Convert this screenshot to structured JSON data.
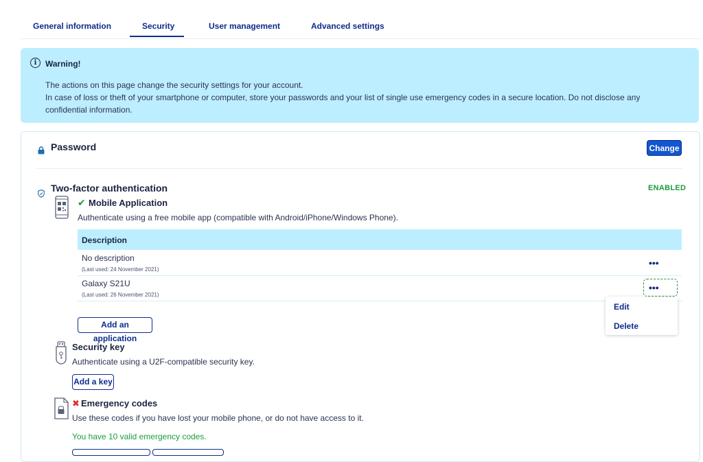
{
  "tabs": [
    {
      "label": "General information"
    },
    {
      "label": "Security"
    },
    {
      "label": "User management"
    },
    {
      "label": "Advanced settings"
    }
  ],
  "active_tab": "Security",
  "warning": {
    "title": "Warning!",
    "line1": "The actions on this page change the security settings for your account.",
    "line2": "In case of loss or theft of your smartphone or computer, store your passwords and your list of single use emergency codes in a secure location. Do not disclose any confidential information."
  },
  "password": {
    "title": "Password",
    "change_label": "Change"
  },
  "two_factor": {
    "title": "Two-factor authentication",
    "status": "ENABLED",
    "mobile": {
      "title": "Mobile Application",
      "description": "Authenticate using a free mobile app (compatible with Android/iPhone/Windows Phone).",
      "table_header": "Description",
      "rows": [
        {
          "name": "No description",
          "last_used": "(Last used: 24 November 2021)"
        },
        {
          "name": "Galaxy S21U",
          "last_used": "(Last used: 26 November 2021)"
        }
      ],
      "actions_label": "•••",
      "menu": {
        "edit": "Edit",
        "delete": "Delete"
      },
      "add_label": "Add an application"
    },
    "security_key": {
      "title": "Security key",
      "description": "Authenticate using a U2F-compatible security key.",
      "add_label": "Add a key"
    },
    "emergency": {
      "title": "Emergency codes",
      "description": "Use these codes if you have lost your mobile phone, or do not have access to it.",
      "valid_text": "You have 10 valid emergency codes."
    }
  },
  "colors": {
    "primary": "#0d2c8c",
    "button_fill": "#1256d0",
    "info_bg": "#bdeeff",
    "success": "#1a9c3d",
    "error": "#e22a2a"
  },
  "icons": [
    "info-icon",
    "lock-icon",
    "shield-icon",
    "qr-phone-icon",
    "check-icon",
    "usb-key-icon",
    "document-lock-icon",
    "cross-icon",
    "more-icon"
  ]
}
